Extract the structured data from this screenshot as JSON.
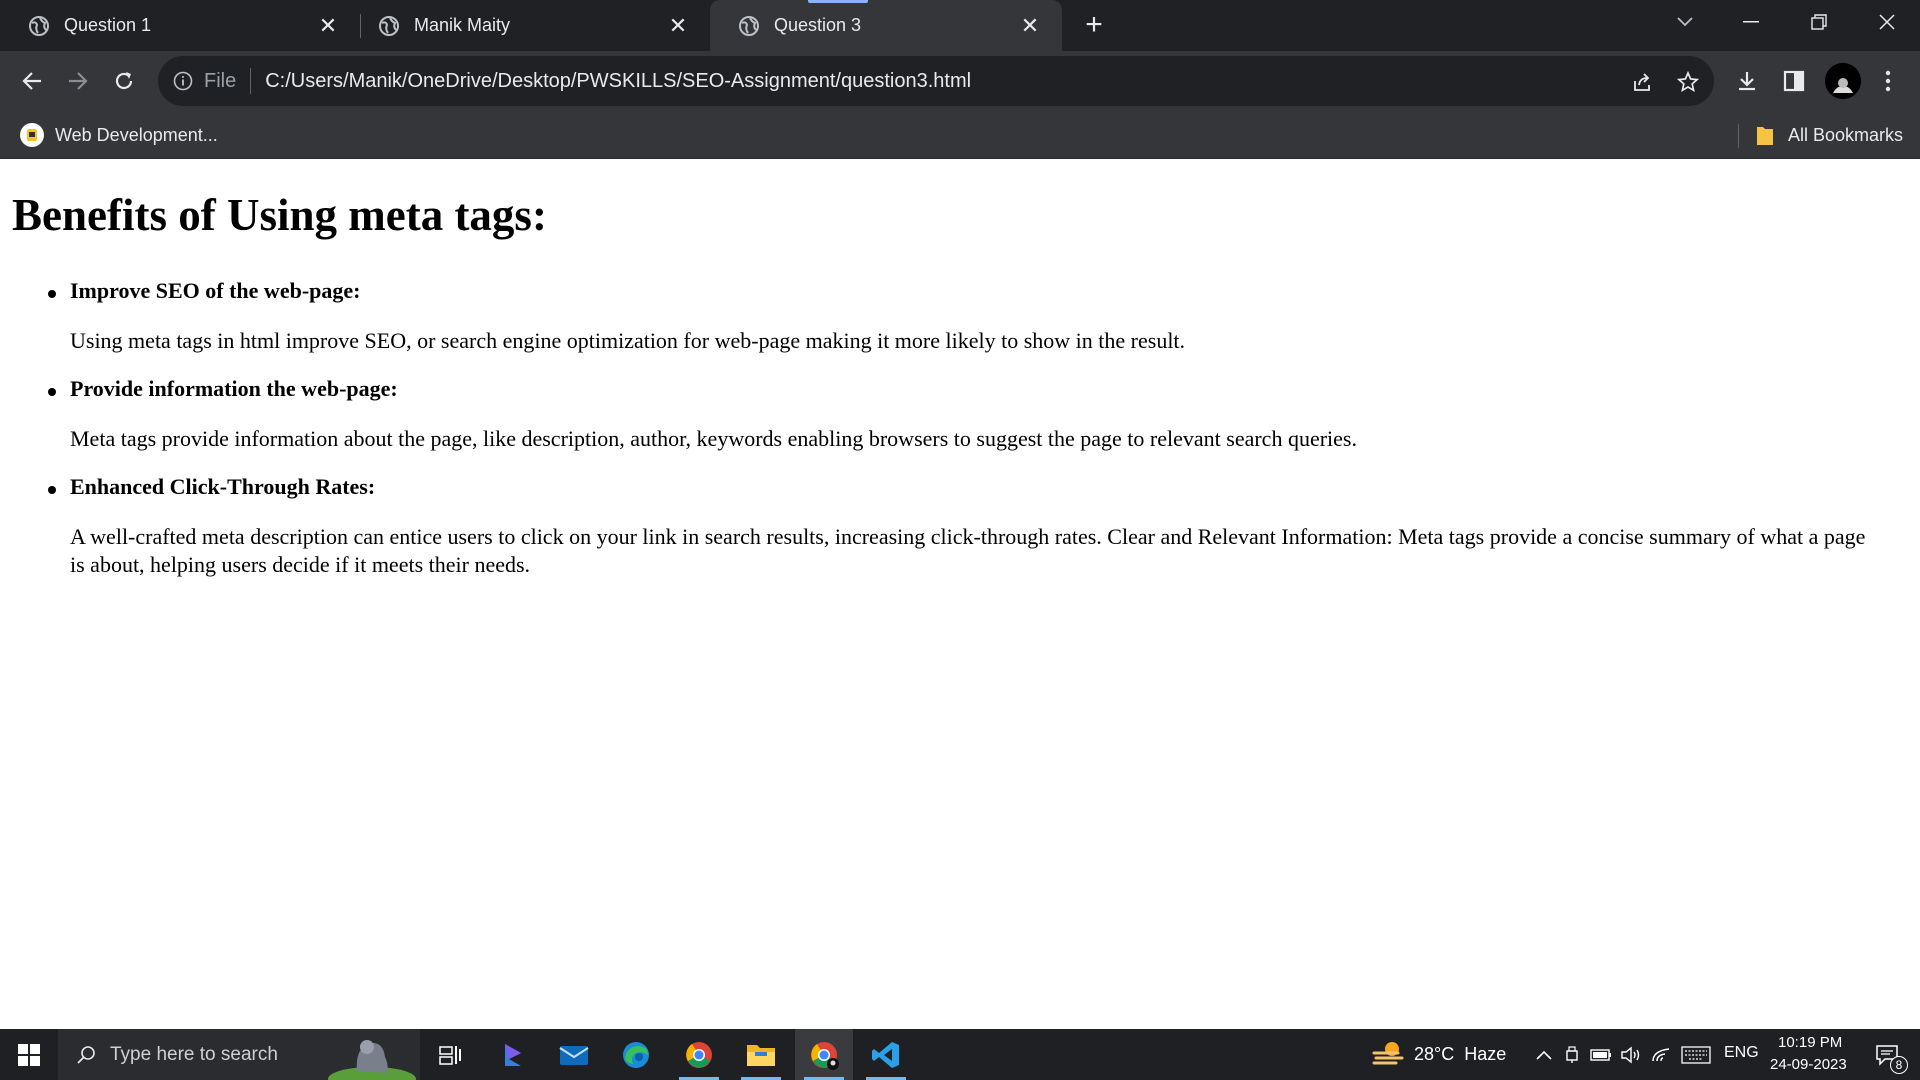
{
  "browser": {
    "tabs": [
      {
        "title": "Question 1",
        "active": false
      },
      {
        "title": "Manik Maity",
        "active": false
      },
      {
        "title": "Question 3",
        "active": true
      }
    ],
    "address": {
      "scheme_label": "File",
      "url": "C:/Users/Manik/OneDrive/Desktop/PWSKILLS/SEO-Assignment/question3.html"
    },
    "bookmarks": {
      "left_item": "Web Development...",
      "all_bookmarks": "All Bookmarks"
    }
  },
  "content": {
    "heading": "Benefits of Using meta tags:",
    "items": [
      {
        "title": "Improve SEO of the web-page:",
        "text": "Using meta tags in html improve SEO, or search engine optimization for web-page making it more likely to show in the result."
      },
      {
        "title": "Provide information the web-page:",
        "text": "Meta tags provide information about the page, like description, author, keywords enabling browsers to suggest the page to relevant search queries."
      },
      {
        "title": "Enhanced Click-Through Rates:",
        "text": "A well-crafted meta description can entice users to click on your link in search results, increasing click-through rates. Clear and Relevant Information: Meta tags provide a concise summary of what a page is about, helping users decide if it meets their needs."
      }
    ]
  },
  "taskbar": {
    "search_placeholder": "Type here to search",
    "weather": "28°C  Haze",
    "language": "ENG",
    "time": "10:19 PM",
    "date": "24-09-2023",
    "notification_count": "8"
  },
  "colors": {
    "tab_strip": "#202124",
    "toolbar": "#35363a",
    "omnibox": "#202124",
    "taskbar": "#1f2023",
    "active_indicator": "#8ab4f8"
  }
}
